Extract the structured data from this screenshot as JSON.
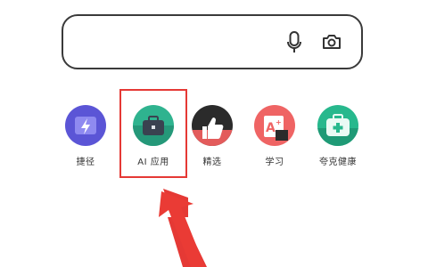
{
  "search": {
    "mic_icon": "microphone-icon",
    "camera_icon": "camera-icon"
  },
  "shortcuts": [
    {
      "label": "捷径",
      "icon": "lightning-folder-icon",
      "color": "#5b55d6"
    },
    {
      "label": "AI 应用",
      "icon": "briefcase-icon",
      "color": "#2fb38f"
    },
    {
      "label": "精选",
      "icon": "thumbs-up-icon",
      "color": "#2b2b2b"
    },
    {
      "label": "学习",
      "icon": "study-book-icon",
      "color": "#ef6464"
    },
    {
      "label": "夸克健康",
      "icon": "medical-kit-icon",
      "color": "#27b88d"
    }
  ],
  "highlight_color": "#e53935"
}
